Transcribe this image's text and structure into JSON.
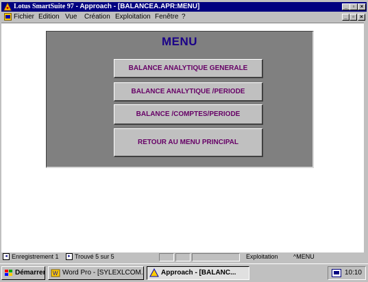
{
  "window": {
    "app_name": "Lotus SmartSuite 97",
    "title_rest": " - Approach - [BALANCEA.APR:MENU]"
  },
  "menubar": {
    "items": [
      "Fichier",
      "Edition",
      "Vue",
      "Création",
      "Exploitation",
      "Fenêtre",
      "?"
    ]
  },
  "form": {
    "title": "MENU",
    "buttons": [
      "BALANCE ANALYTIQUE GENERALE",
      "BALANCE ANALYTIQUE /PERIODE",
      "BALANCE /COMPTES/PERIODE",
      "RETOUR AU MENU PRINCIPAL"
    ]
  },
  "statusbar": {
    "record": "Enregistrement 1",
    "found": "Trouvé 5 sur 5",
    "mode": "Exploitation",
    "view": "MENU"
  },
  "taskbar": {
    "start": "Démarrer",
    "tasks": [
      "Word Pro - [SYLEXLCOM...",
      "Approach - [BALANC..."
    ],
    "clock": "10:10"
  },
  "colors": {
    "titlebar": "#000080",
    "panel": "#808080",
    "form_title": "#1a0088",
    "button_text": "#660066"
  }
}
